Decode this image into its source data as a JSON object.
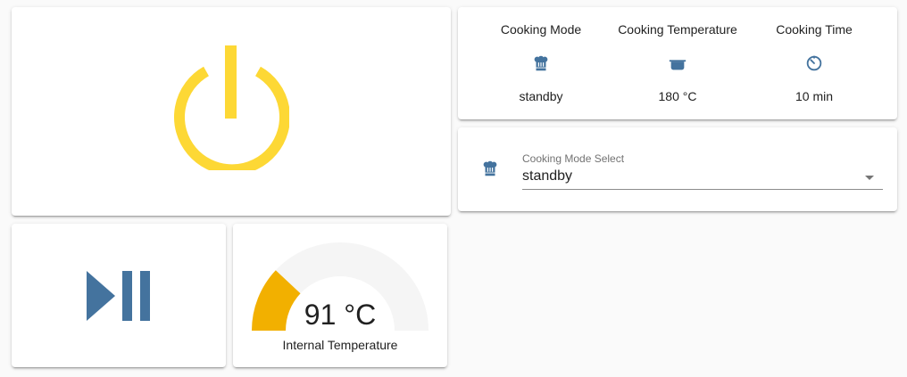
{
  "colors": {
    "power_icon": "#fdd835",
    "primary_icon": "#44739e",
    "gauge_fill": "#f2b000",
    "gauge_track": "#f5f5f5"
  },
  "power_card": {
    "icon": "power-icon"
  },
  "playpause_card": {
    "icon": "play-pause-icon"
  },
  "gauge": {
    "value": "91 °C",
    "name": "Internal Temperature",
    "fraction": 0.24
  },
  "glance": {
    "items": [
      {
        "name": "Cooking Mode",
        "icon": "chef-hat-icon",
        "state": "standby"
      },
      {
        "name": "Cooking Temperature",
        "icon": "pot-icon",
        "state": "180 °C"
      },
      {
        "name": "Cooking Time",
        "icon": "timer-icon",
        "state": "10 min"
      }
    ]
  },
  "select": {
    "label": "Cooking Mode Select",
    "value": "standby",
    "icon": "chef-hat-icon"
  }
}
